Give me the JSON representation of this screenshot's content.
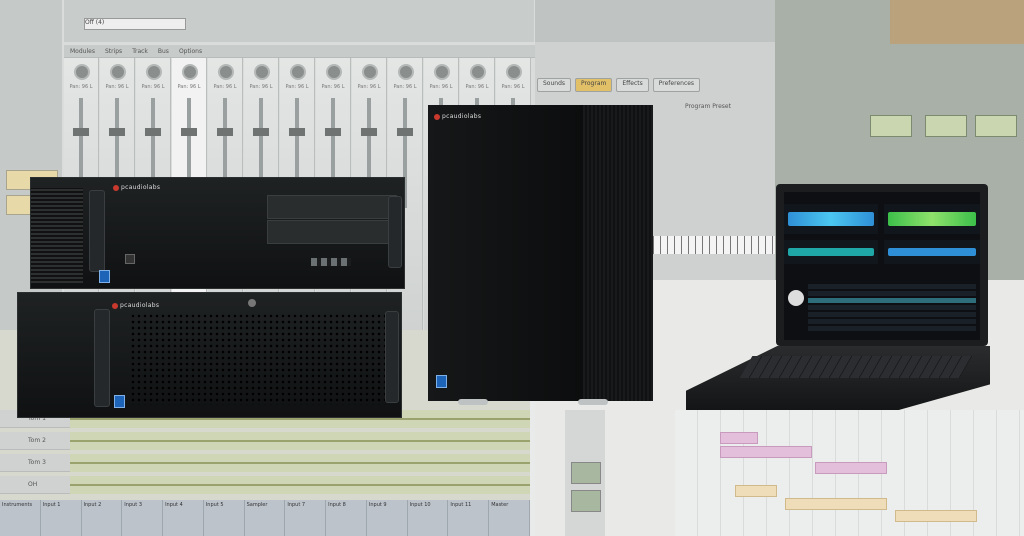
{
  "background": {
    "mixer": {
      "tabs": [
        "Modules",
        "Strips",
        "Track",
        "Bus",
        "Options"
      ],
      "strip_labels": [
        "Pan: 96 L",
        "Pan: 96 L",
        "Pan: 96 L",
        "Pan: 96 L",
        "Pan: 96 L",
        "Pan: 96 L",
        "Pan: 96 L",
        "Pan: 96 L",
        "Pan: 96 L",
        "Pan: 96 L",
        "Pan: 96 L",
        "Pan: 96 L",
        "Pan: 96 L"
      ],
      "input_value": "Off (4)"
    },
    "tracks": [
      "Tom 1",
      "Tom 2",
      "Tom 3",
      "OH"
    ],
    "bottom_bar": [
      "Instruments",
      "Input 1",
      "Input 2",
      "Input 3",
      "Input 4",
      "Input 5",
      "Sampler",
      "Input 7",
      "Input 8",
      "Input 9",
      "Input 10",
      "Input 11",
      "Master"
    ],
    "plugin_tabs": [
      "Sounds",
      "Program",
      "Effects",
      "Preferences"
    ],
    "plugin_preset": "Program Preset"
  },
  "brand": {
    "name": "pcaudiolabs",
    "accent": "#c9392e"
  },
  "products": [
    {
      "name": "rack-4u-top"
    },
    {
      "name": "rack-4u-bottom"
    },
    {
      "name": "tower"
    },
    {
      "name": "laptop"
    }
  ],
  "colors": {
    "hardware_black": "#111314",
    "waveform_blue": "#2f8fd6",
    "waveform_green": "#3bbf4a",
    "waveform_teal": "#1fa7a7"
  }
}
